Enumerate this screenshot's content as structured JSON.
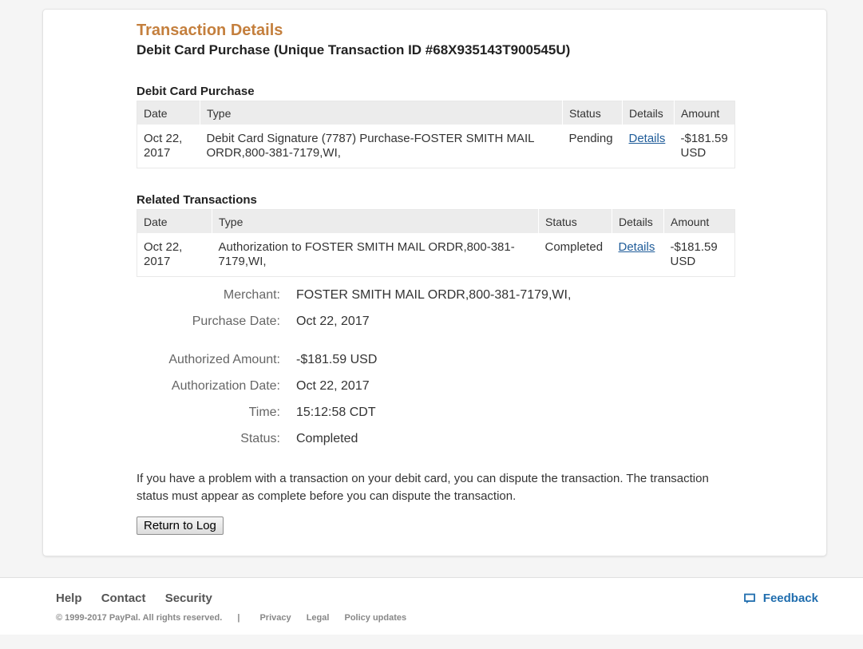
{
  "header": {
    "title": "Transaction Details",
    "subtitle": "Debit Card Purchase (Unique Transaction ID #68X935143T900545U)"
  },
  "purchase_section": {
    "title": "Debit Card Purchase",
    "columns": [
      "Date",
      "Type",
      "Status",
      "Details",
      "Amount"
    ],
    "rows": [
      {
        "date_line1": "Oct 22,",
        "date_line2": "2017",
        "type_line1": "Debit Card Signature (7787) Purchase-FOSTER SMITH MAIL",
        "type_line2": "ORDR,800-381-7179,WI,",
        "status": "Pending",
        "details": "Details",
        "amount_line1": "-$181.59",
        "amount_line2": "USD"
      }
    ]
  },
  "related_section": {
    "title": "Related Transactions",
    "columns": [
      "Date",
      "Type",
      "Status",
      "Details",
      "Amount"
    ],
    "rows": [
      {
        "date_line1": "Oct 22,",
        "date_line2": "2017",
        "type_line1": "Authorization to FOSTER SMITH MAIL ORDR,800-381-",
        "type_line2": "7179,WI,",
        "status": "Completed",
        "details": "Details",
        "amount_line1": "-$181.59",
        "amount_line2": "USD"
      }
    ]
  },
  "info": {
    "merchant_label": "Merchant:",
    "merchant_value": "FOSTER SMITH MAIL ORDR,800-381-7179,WI,",
    "purchase_date_label": "Purchase Date:",
    "purchase_date_value": "Oct 22, 2017",
    "authorized_amount_label": "Authorized Amount:",
    "authorized_amount_value": "-$181.59 USD",
    "authorization_date_label": "Authorization Date:",
    "authorization_date_value": "Oct 22, 2017",
    "time_label": "Time:",
    "time_value": "15:12:58 CDT",
    "status_label": "Status:",
    "status_value": "Completed"
  },
  "notice": {
    "line1": "If you have a problem with a transaction on your debit card, you can dispute the transaction. The transaction",
    "line2": "status must appear as complete before you can dispute the transaction."
  },
  "actions": {
    "return_label": "Return to Log"
  },
  "footer": {
    "help": "Help",
    "contact": "Contact",
    "security": "Security",
    "copyright": "© 1999-2017 PayPal. All rights reserved.",
    "separator": "|",
    "privacy": "Privacy",
    "legal": "Legal",
    "policy_updates": "Policy updates",
    "feedback": "Feedback",
    "feedback_icon": "speech-bubble-icon"
  },
  "colors": {
    "title_accent": "#c47f3d",
    "link": "#1f5c99",
    "feedback": "#1f6dae",
    "page_bg": "#f5f5f5"
  }
}
